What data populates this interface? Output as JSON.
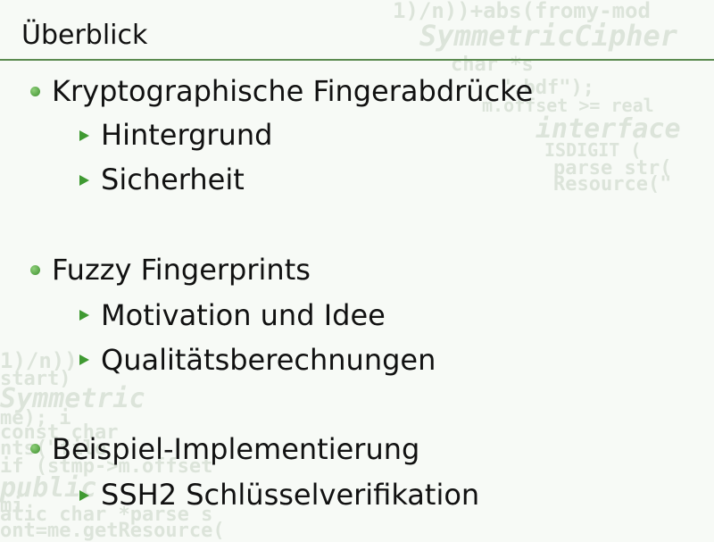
{
  "slide": {
    "title": "Überblick"
  },
  "outline": {
    "section1": {
      "label": "Kryptographische Fingerabdrücke",
      "sub": [
        "Hintergrund",
        "Sicherheit"
      ]
    },
    "section2": {
      "label": "Fuzzy Fingerprints",
      "sub": [
        "Motivation und Idee",
        "Qualitätsberechnungen"
      ]
    },
    "section3": {
      "label": "Beispiel-Implementierung",
      "sub": [
        "SSH2 Schlüsselverifikation"
      ]
    }
  },
  "colors": {
    "accent": "#3f9a32",
    "rule": "#5b8a4f",
    "background": "#f7faf6",
    "text": "#111111"
  },
  "icons": {
    "level1": "round-bullet-icon",
    "level2": "triangle-bullet-icon"
  }
}
